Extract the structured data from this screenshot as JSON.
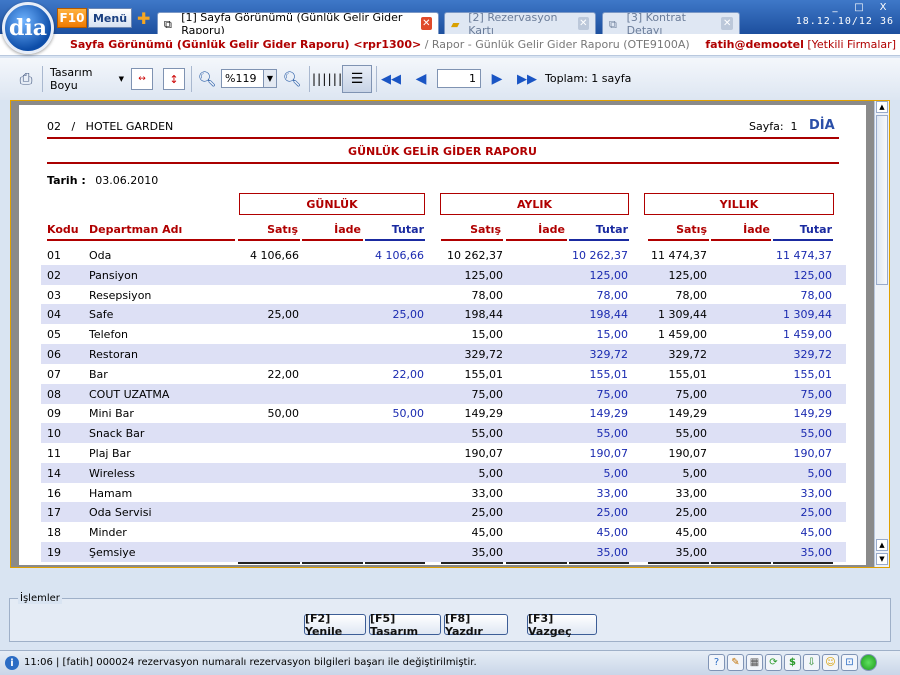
{
  "app": {
    "logo_text": "dia",
    "f10_label": "F10",
    "menu_label": "Menü",
    "add_tab_icon": "plus-icon",
    "clock": "18.12.10/12 36",
    "window_controls": [
      "_",
      "□",
      "X"
    ]
  },
  "tabs": [
    {
      "label": "[1] Sayfa Görünümü (Günlük Gelir Gider Raporu)",
      "active": true,
      "icon": "report-icon"
    },
    {
      "label": "[2] Rezervasyon Kartı",
      "active": false,
      "icon": "folder-icon"
    },
    {
      "label": "[3] Kontrat Detayı",
      "active": false,
      "icon": "report-icon"
    }
  ],
  "path": {
    "main": "Sayfa Görünümü (Günlük Gelir Gider Raporu) <rpr1300>",
    "sub": " / Rapor - Günlük Gelir Gider Raporu (OTE9100A)",
    "user": "fatih@demootel",
    "company": "[Yetkili Firmalar]"
  },
  "toolbar": {
    "design_size_label": "Tasarım Boyu",
    "zoom_value": "%119",
    "page_value": "1",
    "total_label": "Toplam: 1 sayfa"
  },
  "report": {
    "header_left": "02   /   HOTEL GARDEN",
    "page_label": "Sayfa:  1",
    "brand": "DİA",
    "title": "GÜNLÜK GELİR GİDER RAPORU",
    "date_label": "Tarih :",
    "date_value": "03.06.2010",
    "groups": [
      "GÜNLÜK",
      "AYLIK",
      "YILLIK"
    ],
    "col_kodu": "Kodu",
    "col_dept": "Departman Adı",
    "sub_cols": [
      "Satış",
      "İade",
      "Tutar"
    ],
    "rows": [
      {
        "kod": "01",
        "ad": "Oda",
        "gs": "4 106,66",
        "gt": "4 106,66",
        "as": "10 262,37",
        "at": "10 262,37",
        "ys": "11 474,37",
        "yt": "11 474,37"
      },
      {
        "kod": "02",
        "ad": "Pansiyon",
        "gs": "",
        "gt": "",
        "as": "125,00",
        "at": "125,00",
        "ys": "125,00",
        "yt": "125,00"
      },
      {
        "kod": "03",
        "ad": "Resepsiyon",
        "gs": "",
        "gt": "",
        "as": "78,00",
        "at": "78,00",
        "ys": "78,00",
        "yt": "78,00"
      },
      {
        "kod": "04",
        "ad": "Safe",
        "gs": "25,00",
        "gt": "25,00",
        "as": "198,44",
        "at": "198,44",
        "ys": "1 309,44",
        "yt": "1 309,44"
      },
      {
        "kod": "05",
        "ad": "Telefon",
        "gs": "",
        "gt": "",
        "as": "15,00",
        "at": "15,00",
        "ys": "1 459,00",
        "yt": "1 459,00"
      },
      {
        "kod": "06",
        "ad": "Restoran",
        "gs": "",
        "gt": "",
        "as": "329,72",
        "at": "329,72",
        "ys": "329,72",
        "yt": "329,72"
      },
      {
        "kod": "07",
        "ad": "Bar",
        "gs": "22,00",
        "gt": "22,00",
        "as": "155,01",
        "at": "155,01",
        "ys": "155,01",
        "yt": "155,01"
      },
      {
        "kod": "08",
        "ad": "COUT UZATMA",
        "gs": "",
        "gt": "",
        "as": "75,00",
        "at": "75,00",
        "ys": "75,00",
        "yt": "75,00"
      },
      {
        "kod": "09",
        "ad": "Mini Bar",
        "gs": "50,00",
        "gt": "50,00",
        "as": "149,29",
        "at": "149,29",
        "ys": "149,29",
        "yt": "149,29"
      },
      {
        "kod": "10",
        "ad": "Snack Bar",
        "gs": "",
        "gt": "",
        "as": "55,00",
        "at": "55,00",
        "ys": "55,00",
        "yt": "55,00"
      },
      {
        "kod": "11",
        "ad": "Plaj Bar",
        "gs": "",
        "gt": "",
        "as": "190,07",
        "at": "190,07",
        "ys": "190,07",
        "yt": "190,07"
      },
      {
        "kod": "14",
        "ad": "Wireless",
        "gs": "",
        "gt": "",
        "as": "5,00",
        "at": "5,00",
        "ys": "5,00",
        "yt": "5,00"
      },
      {
        "kod": "16",
        "ad": "Hamam",
        "gs": "",
        "gt": "",
        "as": "33,00",
        "at": "33,00",
        "ys": "33,00",
        "yt": "33,00"
      },
      {
        "kod": "17",
        "ad": "Oda Servisi",
        "gs": "",
        "gt": "",
        "as": "25,00",
        "at": "25,00",
        "ys": "25,00",
        "yt": "25,00"
      },
      {
        "kod": "18",
        "ad": "Minder",
        "gs": "",
        "gt": "",
        "as": "45,00",
        "at": "45,00",
        "ys": "45,00",
        "yt": "45,00"
      },
      {
        "kod": "19",
        "ad": "Şemsiye",
        "gs": "",
        "gt": "",
        "as": "35,00",
        "at": "35,00",
        "ys": "35,00",
        "yt": "35,00"
      }
    ]
  },
  "actions": {
    "group_label": "İşlemler",
    "refresh": "[F2] Yenile",
    "design": "[F5] Tasarım",
    "print": "[F8] Yazdır",
    "cancel": "[F3] Vazgeç"
  },
  "status": {
    "text": "11:06 | [fatih] 000024 rezervasyon numaralı rezervasyon bilgileri başarı ile değiştirilmiştir.",
    "info_icon": "info-icon",
    "tray_icons": [
      "help-icon",
      "tools-icon",
      "calculator-icon",
      "sync-icon",
      "currency-icon",
      "download-icon",
      "smiley-icon",
      "lock-icon",
      "online-status-icon"
    ]
  }
}
